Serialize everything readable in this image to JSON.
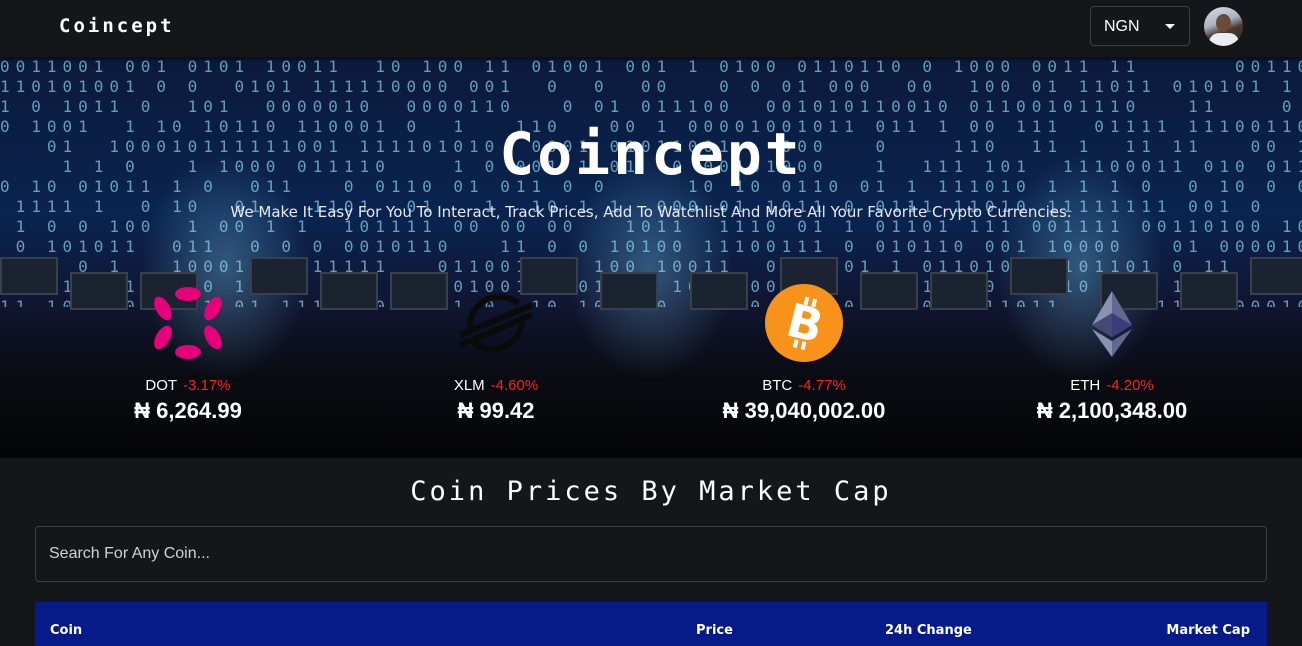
{
  "header": {
    "brand": "Coincept",
    "currency": "NGN"
  },
  "hero": {
    "title": "Coincept",
    "subtitle": "We Make It Easy For You To Interact, Track Prices, Add To Watchlist And More All Your Favorite Crypto Currencies.",
    "coins": [
      {
        "symbol": "DOT",
        "change": "-3.17%",
        "price": "₦ 6,264.99",
        "icon": "polkadot-icon",
        "color": "#e6007a"
      },
      {
        "symbol": "XLM",
        "change": "-4.60%",
        "price": "₦ 99.42",
        "icon": "stellar-icon",
        "color": "#000000"
      },
      {
        "symbol": "BTC",
        "change": "-4.77%",
        "price": "₦ 39,040,002.00",
        "icon": "bitcoin-icon",
        "color": "#f7931a"
      },
      {
        "symbol": "ETH",
        "change": "-4.20%",
        "price": "₦ 2,100,348.00",
        "icon": "ethereum-icon",
        "color": "#8a92b2"
      }
    ]
  },
  "market": {
    "title": "Coin Prices By Market Cap",
    "search_placeholder": "Search For Any Coin...",
    "columns": [
      "Coin",
      "Price",
      "24h Change",
      "Market Cap"
    ]
  },
  "colors": {
    "accent": "#061a8a",
    "negative": "#ff1f1f",
    "background": "#14161a"
  }
}
